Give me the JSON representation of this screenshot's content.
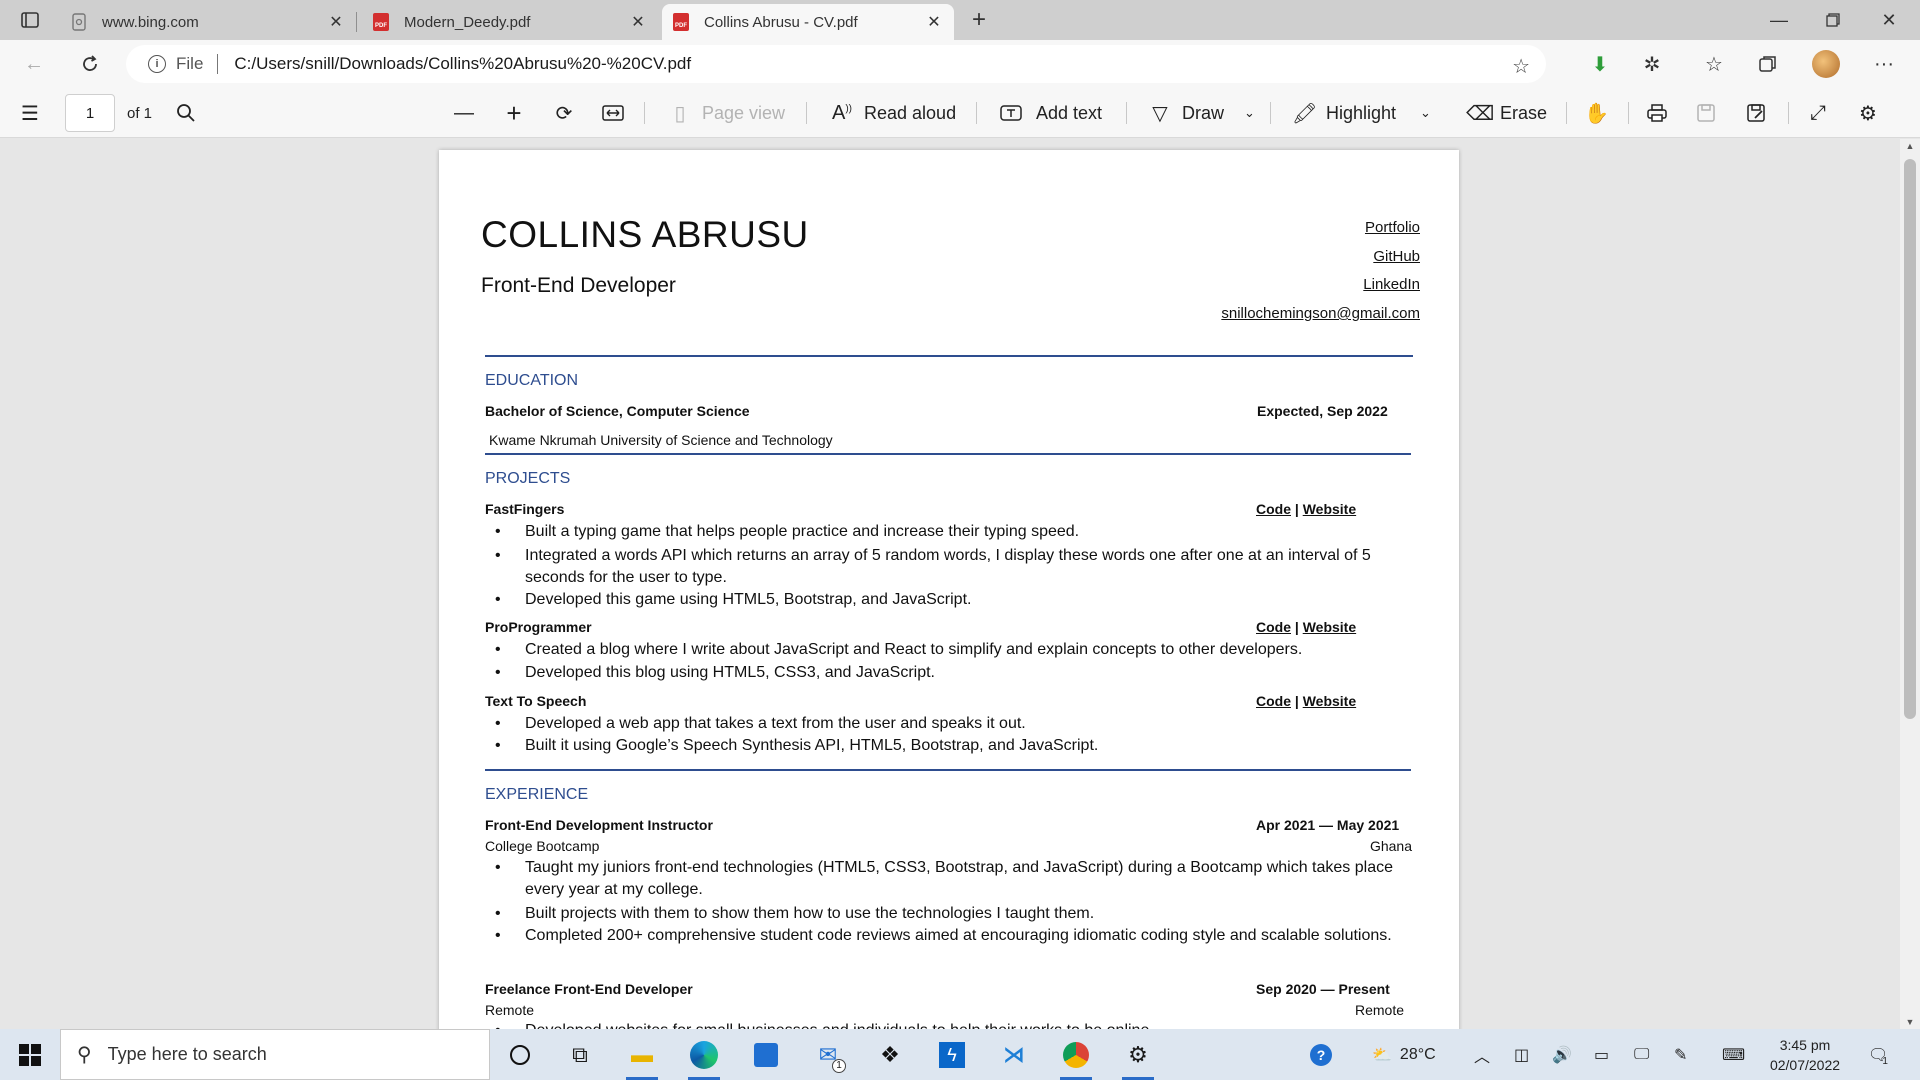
{
  "browser": {
    "tabs": [
      {
        "title": "www.bing.com",
        "favicon": "bing-page-icon",
        "active": false
      },
      {
        "title": "Modern_Deedy.pdf",
        "favicon": "pdf-icon",
        "active": false
      },
      {
        "title": "Collins Abrusu - CV.pdf",
        "favicon": "pdf-icon",
        "active": true
      }
    ],
    "address": {
      "scheme": "File",
      "url": "C:/Users/snill/Downloads/Collins%20Abrusu%20-%20CV.pdf"
    }
  },
  "pdf_toolbar": {
    "page_number": "1",
    "page_count": "of 1",
    "page_view": "Page view",
    "read_aloud": "Read aloud",
    "add_text": "Add text",
    "draw": "Draw",
    "highlight": "Highlight",
    "erase": "Erase"
  },
  "cv": {
    "name": "COLLINS ABRUSU",
    "role": "Front-End Developer",
    "links": [
      "Portfolio",
      "GitHub",
      "LinkedIn",
      "snillochemingson@gmail.com"
    ],
    "education": {
      "title": "EDUCATION",
      "degree": "Bachelor of Science, Computer Science",
      "date": "Expected, Sep 2022",
      "school": "Kwame Nkrumah University of Science and Technology"
    },
    "projects": {
      "title": "PROJECTS",
      "code_label": "Code",
      "sep": "|",
      "website_label": "Website",
      "items": [
        {
          "name": "FastFingers",
          "bullets": [
            "Built a typing game that helps people practice and increase their typing speed.",
            "Integrated a words API which returns an array of 5 random words, I display these words one after one at an interval of 5 seconds for the user to type.",
            "Developed this game using HTML5, Bootstrap, and JavaScript."
          ]
        },
        {
          "name": "ProProgrammer",
          "bullets": [
            "Created a blog where I write about JavaScript and React to simplify and explain concepts to other developers.",
            "Developed this blog using HTML5, CSS3, and JavaScript."
          ]
        },
        {
          "name": "Text To Speech",
          "bullets": [
            "Developed a web app that takes a text from the user and speaks it out.",
            "Built it using Google’s Speech Synthesis API, HTML5, Bootstrap, and JavaScript."
          ]
        }
      ]
    },
    "experience": {
      "title": "EXPERIENCE",
      "items": [
        {
          "role": "Front-End Development Instructor",
          "dates": "Apr 2021 — May 2021",
          "org": "College Bootcamp",
          "location": "Ghana",
          "bullets": [
            "Taught my juniors front-end technologies (HTML5, CSS3, Bootstrap, and JavaScript) during a Bootcamp which takes place every year at my college.",
            "Built projects with them to show them how to use the technologies I taught them.",
            "Completed 200+ comprehensive student code reviews aimed at encouraging idiomatic coding style and scalable solutions."
          ]
        },
        {
          "role": "Freelance Front-End Developer",
          "dates": "Sep 2020 — Present",
          "org": "Remote",
          "location": "Remote",
          "bullets": [
            "Developed websites for small businesses and individuals to help their works to be online."
          ]
        }
      ]
    }
  },
  "taskbar": {
    "search_placeholder": "Type here to search",
    "weather": "28°C",
    "time": "3:45 pm",
    "date": "02/07/2022",
    "mail_badge": "1",
    "notification_badge": "1"
  },
  "colors": {
    "section_accent": "#2e4d8f",
    "taskbar": "#dde6f0"
  }
}
